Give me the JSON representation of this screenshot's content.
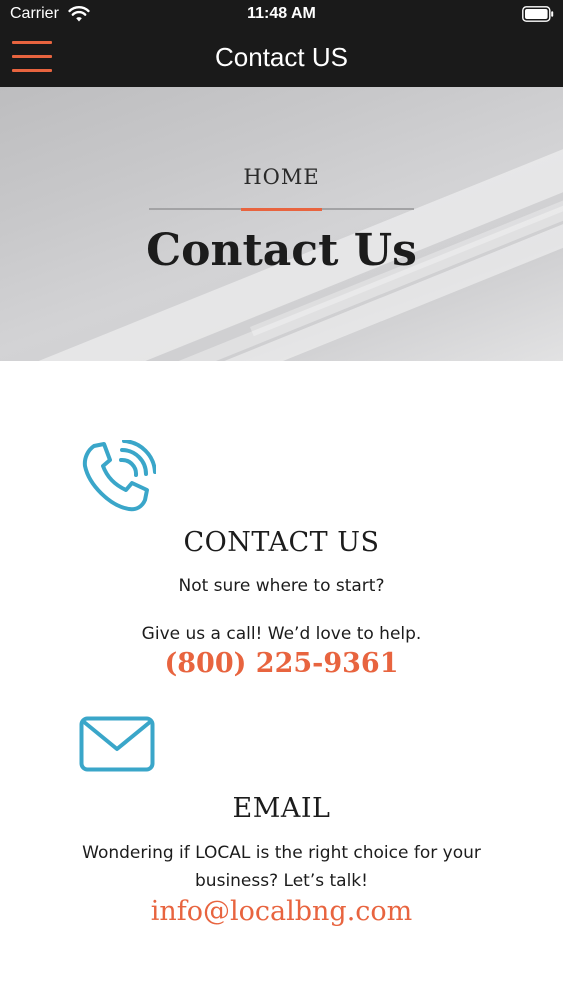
{
  "status_bar": {
    "carrier": "Carrier",
    "time": "11:48 AM",
    "icons": [
      "wifi-icon",
      "battery-icon"
    ]
  },
  "nav": {
    "title": "Contact US",
    "menu_icon": "hamburger-menu-icon"
  },
  "hero": {
    "breadcrumb": "HOME",
    "title": "Contact Us"
  },
  "contact": {
    "icon": "phone-icon",
    "heading": "CONTACT US",
    "line1": "Not sure where to start?",
    "line2": "Give us a call! We’d love to help.",
    "phone": "(800) 225-9361"
  },
  "email": {
    "icon": "envelope-icon",
    "heading": "EMAIL",
    "line1": "Wondering if LOCAL is the right choice for your",
    "line2": "business? Let’s talk!",
    "address": "info@localbng.com"
  },
  "colors": {
    "accent": "#e8643f",
    "icon_blue": "#3aa6c9",
    "bar_bg": "#1a1a1a"
  }
}
